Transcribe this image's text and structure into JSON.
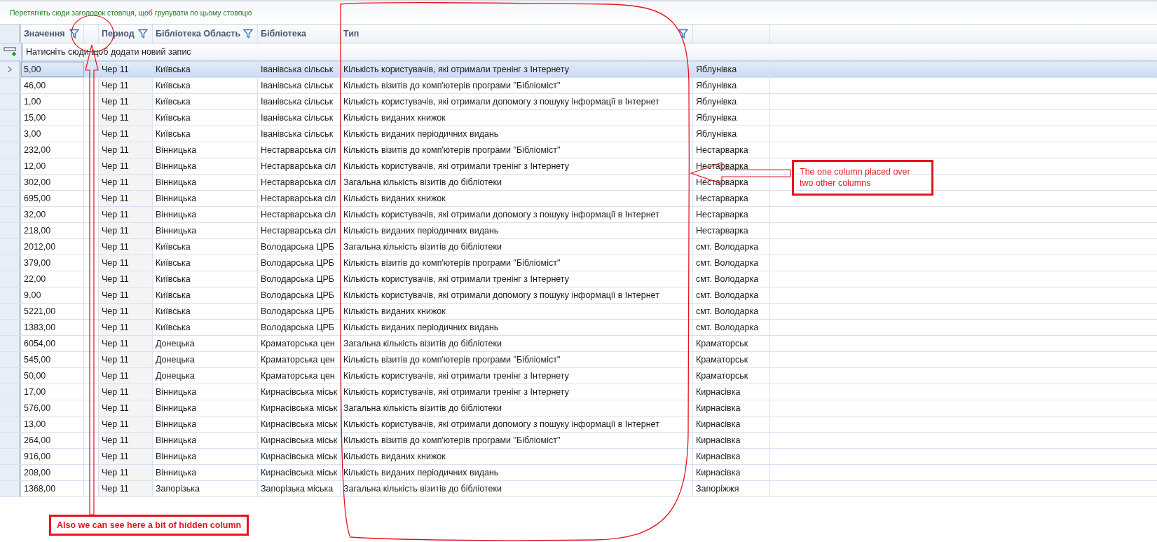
{
  "group_panel": {
    "hint": "Перетягніть сюди заголовок стовпця, щоб групувати по цьому стовпцю"
  },
  "columns": [
    {
      "label": "Значення",
      "filter": true
    },
    {
      "label": "Период",
      "filter": true
    },
    {
      "label": "Бібліотека Область",
      "filter": true
    },
    {
      "label": "Бібліотека",
      "filter": false
    },
    {
      "label": "Тип",
      "filter": true
    }
  ],
  "new_row": {
    "label": "Натисніть сюди щоб додати новий запис"
  },
  "rows": [
    {
      "value": "5,00",
      "period": "Чер 11",
      "region": "Київська",
      "library": "Іванівська сільськ",
      "type": "Кількість користувачів, які отримали тренінг з Інтернету",
      "place": "Яблунівка",
      "selected": true
    },
    {
      "value": "46,00",
      "period": "Чер 11",
      "region": "Київська",
      "library": "Іванівська сільськ",
      "type": "Кількість візитів до комп'ютерів програми \"Бібліоміст\"",
      "place": "Яблунівка",
      "selected": false
    },
    {
      "value": "1,00",
      "period": "Чер 11",
      "region": "Київська",
      "library": "Іванівська сільськ",
      "type": "Кількість користувачів, які отримали допомогу з пошуку інформації в Інтернет",
      "place": "Яблунівка",
      "selected": false
    },
    {
      "value": "15,00",
      "period": "Чер 11",
      "region": "Київська",
      "library": "Іванівська сільськ",
      "type": "Кількість виданих книжок",
      "place": "Яблунівка",
      "selected": false
    },
    {
      "value": "3,00",
      "period": "Чер 11",
      "region": "Київська",
      "library": "Іванівська сільськ",
      "type": "Кількість виданих періодичних видань",
      "place": "Яблунівка",
      "selected": false
    },
    {
      "value": "232,00",
      "period": "Чер 11",
      "region": "Вінницька",
      "library": "Нестарварська сіл",
      "type": "Кількість візитів до комп'ютерів програми \"Бібліоміст\"",
      "place": "Нестарварка",
      "selected": false
    },
    {
      "value": "12,00",
      "period": "Чер 11",
      "region": "Вінницька",
      "library": "Нестарварська сіл",
      "type": "Кількість користувачів, які отримали тренінг з Інтернету",
      "place": "Нестарварка",
      "selected": false
    },
    {
      "value": "302,00",
      "period": "Чер 11",
      "region": "Вінницька",
      "library": "Нестарварська сіл",
      "type": "Загальна кількість візитів до бібліотеки",
      "place": "Нестарварка",
      "selected": false
    },
    {
      "value": "695,00",
      "period": "Чер 11",
      "region": "Вінницька",
      "library": "Нестарварська сіл",
      "type": "Кількість виданих книжок",
      "place": "Нестарварка",
      "selected": false
    },
    {
      "value": "32,00",
      "period": "Чер 11",
      "region": "Вінницька",
      "library": "Нестарварська сіл",
      "type": "Кількість користувачів, які отримали допомогу з пошуку інформації в Інтернет",
      "place": "Нестарварка",
      "selected": false
    },
    {
      "value": "218,00",
      "period": "Чер 11",
      "region": "Вінницька",
      "library": "Нестарварська сіл",
      "type": "Кількість виданих періодичних видань",
      "place": "Нестарварка",
      "selected": false
    },
    {
      "value": "2012,00",
      "period": "Чер 11",
      "region": "Київська",
      "library": "Володарська ЦРБ",
      "type": "Загальна кількість візитів до бібліотеки",
      "place": "смт. Володарка",
      "selected": false
    },
    {
      "value": "379,00",
      "period": "Чер 11",
      "region": "Київська",
      "library": "Володарська ЦРБ",
      "type": "Кількість візитів до комп'ютерів програми \"Бібліоміст\"",
      "place": "смт. Володарка",
      "selected": false
    },
    {
      "value": "22,00",
      "period": "Чер 11",
      "region": "Київська",
      "library": "Володарська ЦРБ",
      "type": "Кількість користувачів, які отримали тренінг з Інтернету",
      "place": "смт. Володарка",
      "selected": false
    },
    {
      "value": "9,00",
      "period": "Чер 11",
      "region": "Київська",
      "library": "Володарська ЦРБ",
      "type": "Кількість користувачів, які отримали допомогу з пошуку інформації в Інтернет",
      "place": "смт. Володарка",
      "selected": false
    },
    {
      "value": "5221,00",
      "period": "Чер 11",
      "region": "Київська",
      "library": "Володарська ЦРБ",
      "type": "Кількість виданих книжок",
      "place": "смт. Володарка",
      "selected": false
    },
    {
      "value": "1383,00",
      "period": "Чер 11",
      "region": "Київська",
      "library": "Володарська ЦРБ",
      "type": "Кількість виданих періодичних видань",
      "place": "смт. Володарка",
      "selected": false
    },
    {
      "value": "6054,00",
      "period": "Чер 11",
      "region": "Донецька",
      "library": "Краматорська цен",
      "type": "Загальна кількість візитів до бібліотеки",
      "place": "Краматорськ",
      "selected": false
    },
    {
      "value": "545,00",
      "period": "Чер 11",
      "region": "Донецька",
      "library": "Краматорська цен",
      "type": "Кількість візитів до комп'ютерів програми \"Бібліоміст\"",
      "place": "Краматорськ",
      "selected": false
    },
    {
      "value": "50,00",
      "period": "Чер 11",
      "region": "Донецька",
      "library": "Краматорська цен",
      "type": "Кількість користувачів, які отримали тренінг з Інтернету",
      "place": "Краматорськ",
      "selected": false
    },
    {
      "value": "17,00",
      "period": "Чер 11",
      "region": "Вінницька",
      "library": "Кирнасівська міськ",
      "type": "Кількість користувачів, які отримали тренінг з Інтернету",
      "place": "Кирнасівка",
      "selected": false
    },
    {
      "value": "576,00",
      "period": "Чер 11",
      "region": "Вінницька",
      "library": "Кирнасівська міськ",
      "type": "Загальна кількість візитів до бібліотеки",
      "place": "Кирнасівка",
      "selected": false
    },
    {
      "value": "13,00",
      "period": "Чер 11",
      "region": "Вінницька",
      "library": "Кирнасівська міськ",
      "type": "Кількість користувачів, які отримали допомогу з пошуку інформації в Інтернет",
      "place": "Кирнасівка",
      "selected": false
    },
    {
      "value": "264,00",
      "period": "Чер 11",
      "region": "Вінницька",
      "library": "Кирнасівська міськ",
      "type": "Кількість візитів до комп'ютерів програми \"Бібліоміст\"",
      "place": "Кирнасівка",
      "selected": false
    },
    {
      "value": "916,00",
      "period": "Чер 11",
      "region": "Вінницька",
      "library": "Кирнасівська міськ",
      "type": "Кількість виданих книжок",
      "place": "Кирнасівка",
      "selected": false
    },
    {
      "value": "208,00",
      "period": "Чер 11",
      "region": "Вінницька",
      "library": "Кирнасівська міськ",
      "type": "Кількість виданих періодичних видань",
      "place": "Кирнасівка",
      "selected": false
    },
    {
      "value": "1368,00",
      "period": "Чер 11",
      "region": "Запорізька",
      "library": "Запорізька міська",
      "type": "Загальна кількість візитів до бібліотеки",
      "place": "Запоріжжя",
      "selected": false
    }
  ],
  "annotations": [
    {
      "text": "Also we can see here a bit of hidden column"
    },
    {
      "text": "The one column placed over two other columns"
    }
  ]
}
